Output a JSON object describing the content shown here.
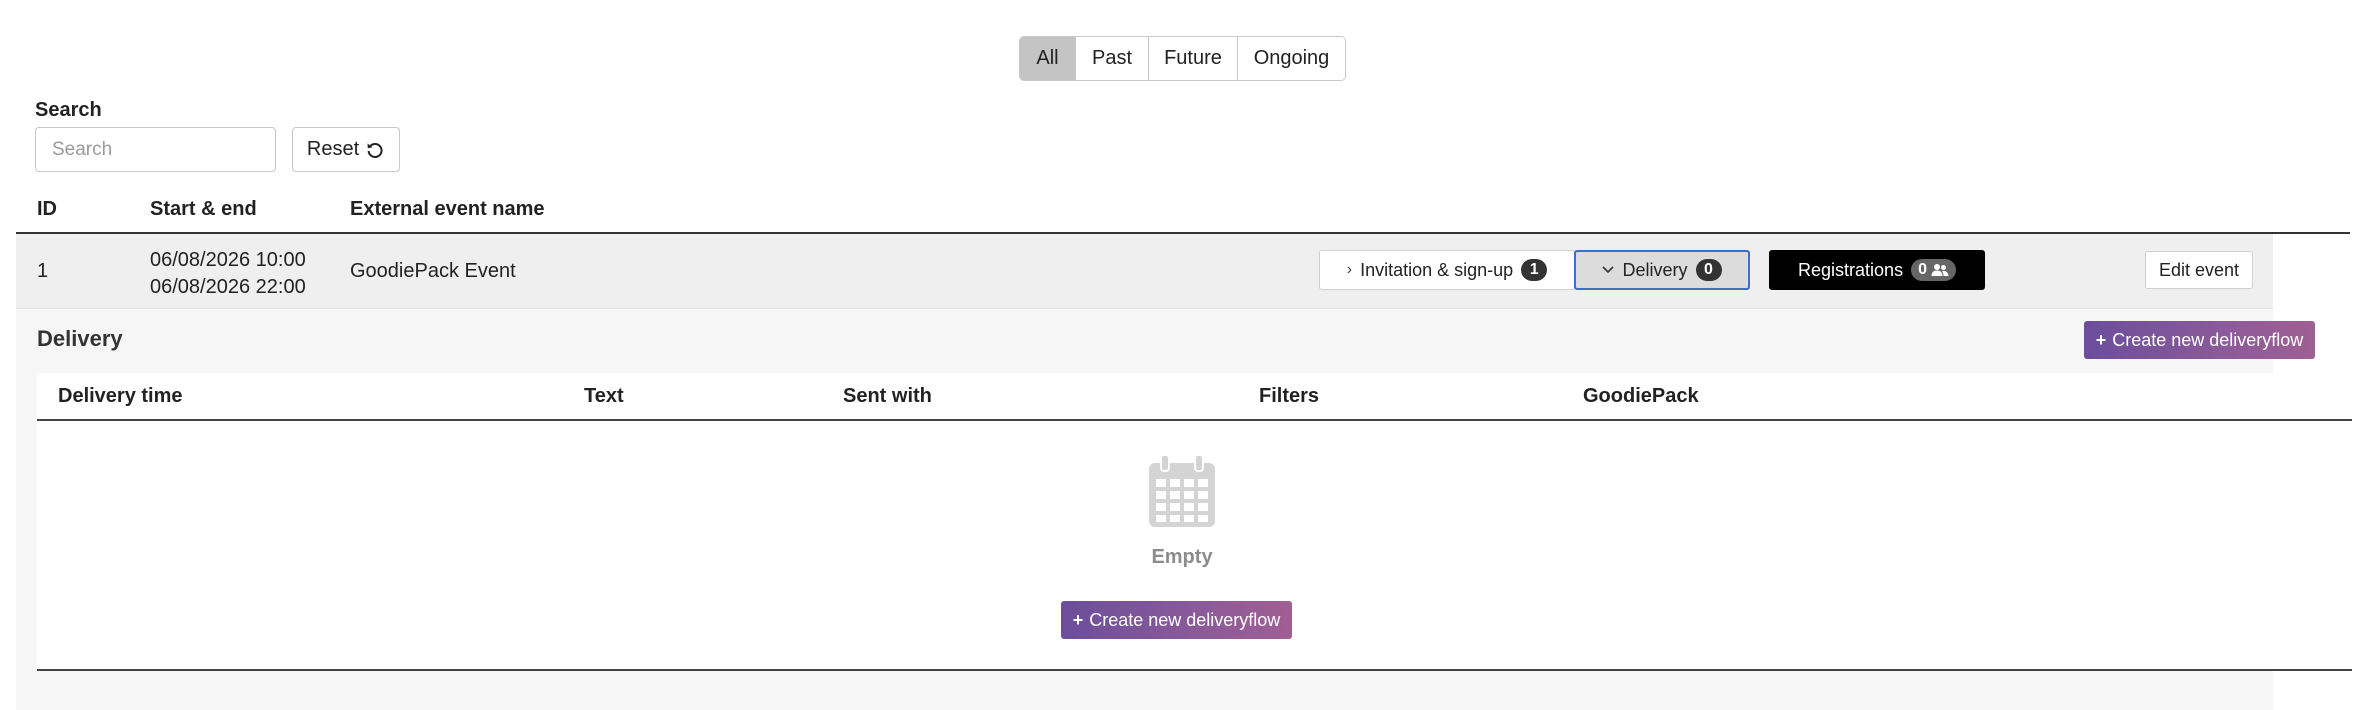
{
  "filters": {
    "items": [
      {
        "label": "All",
        "active": true
      },
      {
        "label": "Past",
        "active": false
      },
      {
        "label": "Future",
        "active": false
      },
      {
        "label": "Ongoing",
        "active": false
      }
    ]
  },
  "search": {
    "label": "Search",
    "placeholder": "Search",
    "value": "",
    "reset_label": "Reset",
    "reset_icon": "undo-icon"
  },
  "events_table": {
    "columns": [
      "ID",
      "Start & end",
      "External event name"
    ],
    "rows": [
      {
        "id": "1",
        "start": "06/08/2026 10:00",
        "end": "06/08/2026 22:00",
        "name": "GoodiePack Event",
        "invite_label": "Invitation & sign-up",
        "invite_count": "1",
        "delivery_label": "Delivery",
        "delivery_count": "0",
        "registrations_label": "Registrations",
        "registrations_count": "0",
        "edit_label": "Edit event"
      }
    ]
  },
  "delivery": {
    "title": "Delivery",
    "create_label": "Create new deliveryflow",
    "columns": [
      "Delivery time",
      "Text",
      "Sent with",
      "Filters",
      "GoodiePack"
    ],
    "empty_text": "Empty",
    "empty_icon": "calendar-icon"
  },
  "colors": {
    "accent_start": "#6b4e9b",
    "accent_end": "#a05f93",
    "active_filter": "#c4c4c4",
    "row_background": "#efefef",
    "focus_border": "#3b6fc9"
  }
}
